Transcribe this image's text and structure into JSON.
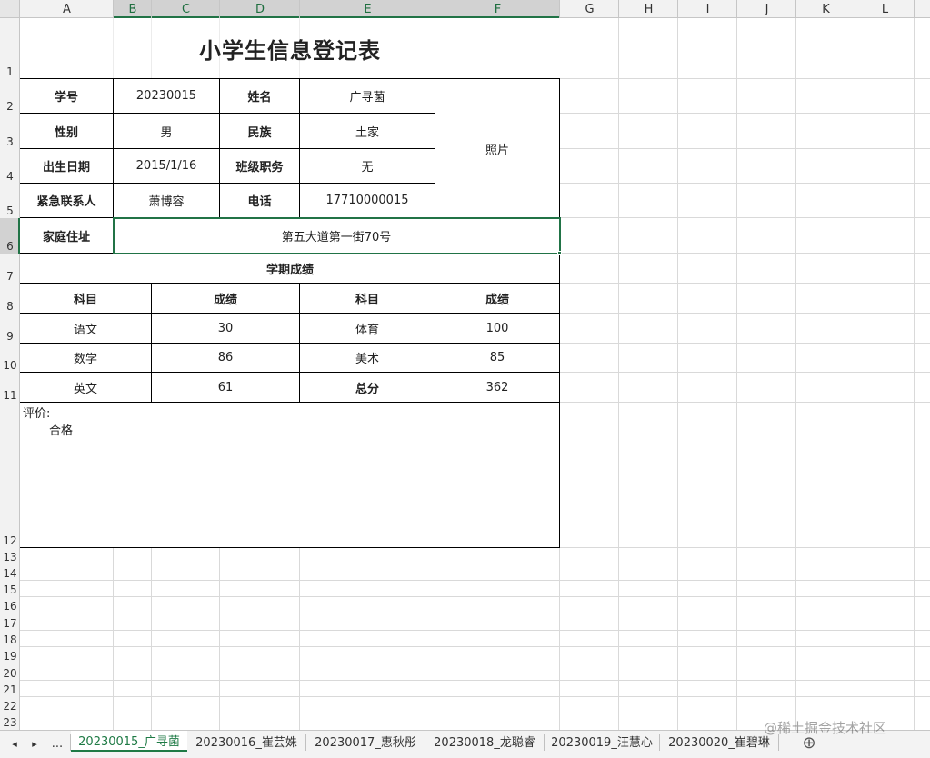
{
  "column_headers": [
    "A",
    "B",
    "C",
    "D",
    "E",
    "F",
    "G",
    "H",
    "I",
    "J",
    "K",
    "L"
  ],
  "row_numbers": [
    "1",
    "2",
    "3",
    "4",
    "5",
    "6",
    "7",
    "8",
    "9",
    "10",
    "11",
    "12",
    "13",
    "14",
    "15",
    "16",
    "17",
    "18",
    "19",
    "20",
    "21",
    "22",
    "23"
  ],
  "form": {
    "title": "小学生信息登记表",
    "labels": {
      "student_id": "学号",
      "name": "姓名",
      "gender": "性别",
      "ethnicity": "民族",
      "birthdate": "出生日期",
      "class_role": "班级职务",
      "emergency_contact": "紧急联系人",
      "phone": "电话",
      "address": "家庭住址"
    },
    "values": {
      "student_id": "20230015",
      "name": "广寻菌",
      "gender": "男",
      "ethnicity": "土家",
      "birthdate": "2015/1/16",
      "class_role": "无",
      "emergency_contact": "萧博容",
      "phone": "17710000015",
      "address": "第五大道第一街70号"
    },
    "photo_label": "照片"
  },
  "grades": {
    "section_title": "学期成绩",
    "headers": [
      "科目",
      "成绩",
      "科目",
      "成绩"
    ],
    "rows": [
      {
        "subject1": "语文",
        "score1": "30",
        "subject2": "体育",
        "score2": "100"
      },
      {
        "subject1": "数学",
        "score1": "86",
        "subject2": "美术",
        "score2": "85"
      },
      {
        "subject1": "英文",
        "score1": "61",
        "subject2": "总分",
        "score2": "362"
      }
    ]
  },
  "evaluation": {
    "label": "评价:",
    "value": "合格"
  },
  "sheet_tabs": [
    "20230015_广寻菌",
    "20230016_崔芸姝",
    "20230017_惠秋彤",
    "20230018_龙聪睿",
    "20230019_汪慧心",
    "20230020_崔碧琳"
  ],
  "sheet_nav": {
    "prev": "◂",
    "next": "▸",
    "more": "...",
    "add": "⊕"
  },
  "watermark": "@稀土掘金技术社区",
  "colors": {
    "grid": "#d9d9d9",
    "header_bg": "#f2f2f2",
    "selection": "#217346",
    "active_tab": "#1e7a45"
  }
}
